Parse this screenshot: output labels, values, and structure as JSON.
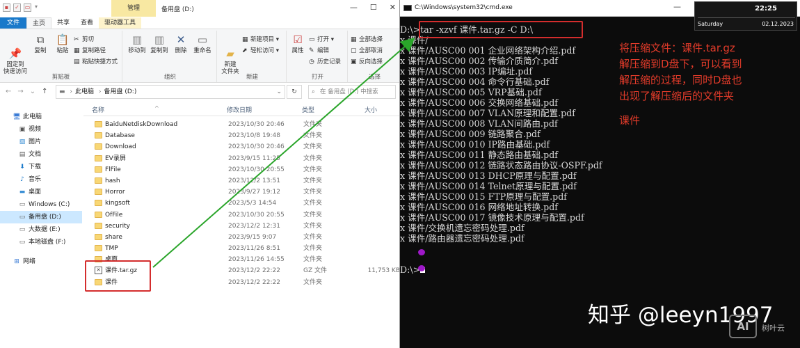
{
  "explorer": {
    "manage_tab": "管理",
    "window_title": "备用盘 (D:)",
    "tabs": [
      "文件",
      "主页",
      "共享",
      "查看",
      "驱动器工具"
    ],
    "ribbon": {
      "clipboard": {
        "pin": "固定到\n快速访问",
        "copy": "复制",
        "paste": "粘贴",
        "cut": "剪切",
        "copy_path": "复制路径",
        "paste_shortcut": "粘贴快捷方式",
        "label": "剪贴板"
      },
      "organize": {
        "move_to": "移动到",
        "copy_to": "复制到",
        "delete": "删除",
        "rename": "重命名",
        "label": "组织"
      },
      "new": {
        "new_folder": "新建\n文件夹",
        "new_item": "新建项目 ▾",
        "easy_access": "轻松访问 ▾",
        "label": "新建"
      },
      "open": {
        "properties": "属性",
        "open": "打开 ▾",
        "edit": "编辑",
        "history": "历史记录",
        "label": "打开"
      },
      "select": {
        "select_all": "全部选择",
        "select_none": "全部取消",
        "invert": "反向选择",
        "label": "选择"
      }
    },
    "address": {
      "crumbs": [
        "此电脑",
        "备用盘 (D:)"
      ],
      "search_placeholder": "在 备用盘 (D:) 中搜索"
    },
    "nav_items": [
      {
        "label": "此电脑",
        "icon": "computer-icon"
      },
      {
        "label": "视频",
        "icon": "video-icon"
      },
      {
        "label": "图片",
        "icon": "picture-icon"
      },
      {
        "label": "文档",
        "icon": "document-icon"
      },
      {
        "label": "下载",
        "icon": "download-icon"
      },
      {
        "label": "音乐",
        "icon": "music-icon"
      },
      {
        "label": "桌面",
        "icon": "desktop-icon"
      },
      {
        "label": "Windows (C:)",
        "icon": "drive-icon"
      },
      {
        "label": "备用盘 (D:)",
        "icon": "drive-icon"
      },
      {
        "label": "大数据 (E:)",
        "icon": "drive-icon"
      },
      {
        "label": "本地磁盘 (F:)",
        "icon": "drive-icon"
      },
      {
        "label": "网络",
        "icon": "network-icon"
      }
    ],
    "columns": {
      "name": "名称",
      "modified": "修改日期",
      "type": "类型",
      "size": "大小"
    },
    "files": [
      {
        "name": "BaiduNetdiskDownload",
        "date": "2023/10/30 20:46",
        "type": "文件夹",
        "size": ""
      },
      {
        "name": "Database",
        "date": "2023/10/8 19:48",
        "type": "文件夹",
        "size": ""
      },
      {
        "name": "Download",
        "date": "2023/10/30 20:46",
        "type": "文件夹",
        "size": ""
      },
      {
        "name": "EV录屏",
        "date": "2023/9/15 11:25",
        "type": "文件夹",
        "size": ""
      },
      {
        "name": "FlFile",
        "date": "2023/10/30 20:55",
        "type": "文件夹",
        "size": ""
      },
      {
        "name": "hash",
        "date": "2023/12/2 13:51",
        "type": "文件夹",
        "size": ""
      },
      {
        "name": "Horror",
        "date": "2023/9/27 19:12",
        "type": "文件夹",
        "size": ""
      },
      {
        "name": "kingsoft",
        "date": "2023/5/3 14:54",
        "type": "文件夹",
        "size": ""
      },
      {
        "name": "OfFile",
        "date": "2023/10/30 20:55",
        "type": "文件夹",
        "size": ""
      },
      {
        "name": "security",
        "date": "2023/12/2 12:31",
        "type": "文件夹",
        "size": ""
      },
      {
        "name": "share",
        "date": "2023/9/15 9:07",
        "type": "文件夹",
        "size": ""
      },
      {
        "name": "TMP",
        "date": "2023/11/26 8:51",
        "type": "文件夹",
        "size": ""
      },
      {
        "name": "桌面",
        "date": "2023/11/26 14:55",
        "type": "文件夹",
        "size": ""
      },
      {
        "name": "课件.tar.gz",
        "date": "2023/12/2 22:22",
        "type": "GZ 文件",
        "size": "11,753 KB"
      },
      {
        "name": "课件",
        "date": "2023/12/2 22:22",
        "type": "文件夹",
        "size": ""
      }
    ]
  },
  "cmd": {
    "title": "C:\\Windows\\system32\\cmd.exe",
    "clock": {
      "time": "22:25",
      "day": "Saturday",
      "date": "02.12.2023"
    },
    "lines": [
      "D:\\>tar -xzvf 课件.tar.gz -C D:\\",
      "x 课件/",
      "x 课件/AUSC00 001 企业网络架构介绍.pdf",
      "x 课件/AUSC00 002 传输介质简介.pdf",
      "x 课件/AUSC00 003 IP编址.pdf",
      "x 课件/AUSC00 004 命令行基础.pdf",
      "x 课件/AUSC00 005 VRP基础.pdf",
      "x 课件/AUSC00 006 交换网络基础.pdf",
      "x 课件/AUSC00 007 VLAN原理和配置.pdf",
      "x 课件/AUSC00 008 VLAN间路由.pdf",
      "x 课件/AUSC00 009 链路聚合.pdf",
      "x 课件/AUSC00 010 IP路由基础.pdf",
      "x 课件/AUSC00 011 静态路由基础.pdf",
      "x 课件/AUSC00 012 链路状态路由协议-OSPF.pdf",
      "x 课件/AUSC00 013 DHCP原理与配置.pdf",
      "x 课件/AUSC00 014 Telnet原理与配置.pdf",
      "x 课件/AUSC00 015 FTP原理与配置.pdf",
      "x 课件/AUSC00 016 网络地址转换.pdf",
      "x 课件/AUSC00 017 镜像技术原理与配置.pdf",
      "x 课件/交换机遗忘密码处理.pdf",
      "x 课件/路由器遗忘密码处理.pdf",
      "",
      ""
    ],
    "prompt": "D:\\>",
    "annotation": "将压缩文件：课件.tar.gz\n解压缩到D盘下，可以看到\n解压缩的过程，同时D盘也\n出现了解压缩后的文件夹",
    "annotation2": "课件",
    "watermark": "知乎 @leeyn1997",
    "logo_mark": "AI",
    "logo_text": "树叶云"
  },
  "colors": {
    "annotation_red": "#e23b2a",
    "highlight_box": "#d42d2d",
    "arrow_green": "#2aa52a",
    "accent_blue": "#1979ca"
  }
}
